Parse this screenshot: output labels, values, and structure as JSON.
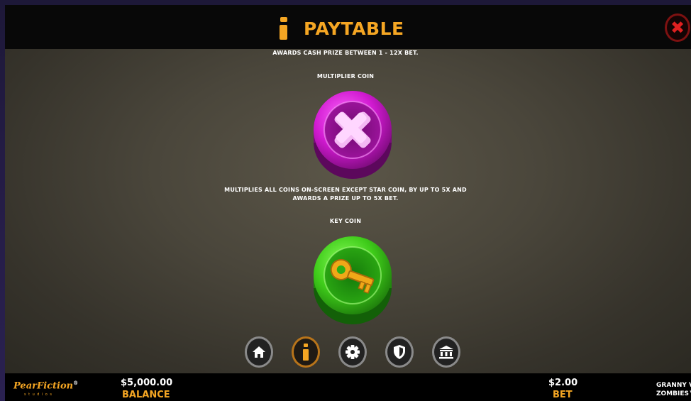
{
  "header": {
    "title": "PAYTABLE",
    "close_label": "✖"
  },
  "content": {
    "awards_text": "AWARDS CASH PRIZE BETWEEN  1 - 12X BET.",
    "multiplier_coin": {
      "title": "MULTIPLIER COIN",
      "description_line1": "MULTIPLIES ALL COINS ON-SCREEN EXCEPT STAR COIN, BY UP TO 5X AND",
      "description_line2": "AWARDS A PRIZE UP TO 5X BET."
    },
    "key_coin": {
      "title": "KEY COIN"
    }
  },
  "nav": [
    {
      "icon": "home-icon",
      "active": false
    },
    {
      "icon": "info-icon",
      "active": true
    },
    {
      "icon": "gear-icon",
      "active": false
    },
    {
      "icon": "shield-icon",
      "active": false
    },
    {
      "icon": "bank-icon",
      "active": false
    }
  ],
  "footer": {
    "logo_text": "PearFiction",
    "logo_mark": "®",
    "logo_sub": "studios",
    "balance_value": "$5,000.00",
    "balance_label": "BALANCE",
    "bet_value": "$2.00",
    "bet_label": "BET",
    "game_name_line1": "GRANNY V",
    "game_name_line2": "ZOMBIES™"
  },
  "colors": {
    "accent": "#f5a623",
    "close": "#e02020",
    "multiplier_coin": "#d21ad2",
    "key_coin": "#3fcc1a"
  }
}
